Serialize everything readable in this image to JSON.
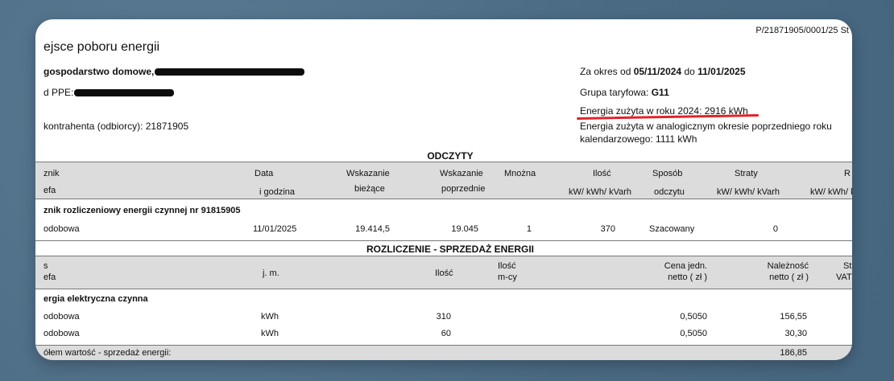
{
  "doc_ref": "P/21871905/0001/25 St",
  "section_title": "ejsce poboru energii",
  "left": {
    "line1": "gospodarstwo domowe,",
    "line2": "d PPE:",
    "line3": "kontrahenta (odbiorcy): 21871905"
  },
  "right": {
    "period_prefix": "Za okres od ",
    "period_from": "05/11/2024",
    "period_mid": " do ",
    "period_to": "11/01/2025",
    "tariff_prefix": "Grupa taryfowa: ",
    "tariff_value": "G11",
    "energy_used": "Energia zużyta w roku 2024: 2916 kWh",
    "energy_prev_1": "Energia zużyta w analogicznym okresie poprzedniego roku",
    "energy_prev_2": "kalendarzowego: 1111 kWh"
  },
  "odczyty": {
    "title": "ODCZYTY",
    "h1": [
      "znik",
      "Data",
      "Wskazanie",
      "Wskazanie",
      "Mnożna",
      "Ilość",
      "Sposób",
      "Straty",
      "R"
    ],
    "h2": [
      "efa",
      "i godzina",
      "bieżące",
      "poprzednie",
      "kW/ kWh/ kVarh",
      "odczytu",
      "kW/ kWh/ kVarh",
      "kW/ kWh/ k"
    ],
    "meter_label": "znik rozliczeniowy   energii czynnej nr  91815905",
    "row": [
      "odobowa",
      "11/01/2025",
      "19.414,5",
      "19.045",
      "1",
      "370",
      "Szacowany",
      "0"
    ]
  },
  "rozliczenie": {
    "title": "ROZLICZENIE - SPRZEDAŻ  ENERGII",
    "h_s": "s",
    "h_efa": "efa",
    "h_jm": "j. m.",
    "h_ilosc": "Ilość",
    "h_ilosc2_1": "Ilość",
    "h_ilosc2_2": "m-cy",
    "h_cena_1": "Cena jedn.",
    "h_cena_2": "netto ( zł )",
    "h_nal_1": "Należność",
    "h_nal_2": "netto ( zł )",
    "h_st_1": "St",
    "h_st_2": "VAT",
    "group_label": "ergia elektryczna czynna",
    "rows": [
      {
        "name": "odobowa",
        "unit": "kWh",
        "qty": "310",
        "price": "0,5050",
        "amount": "156,55"
      },
      {
        "name": "odobowa",
        "unit": "kWh",
        "qty": "60",
        "price": "0,5050",
        "amount": "30,30"
      }
    ],
    "total_label": "ółem wartość - sprzedaż energii:",
    "total_value": "186,85"
  }
}
